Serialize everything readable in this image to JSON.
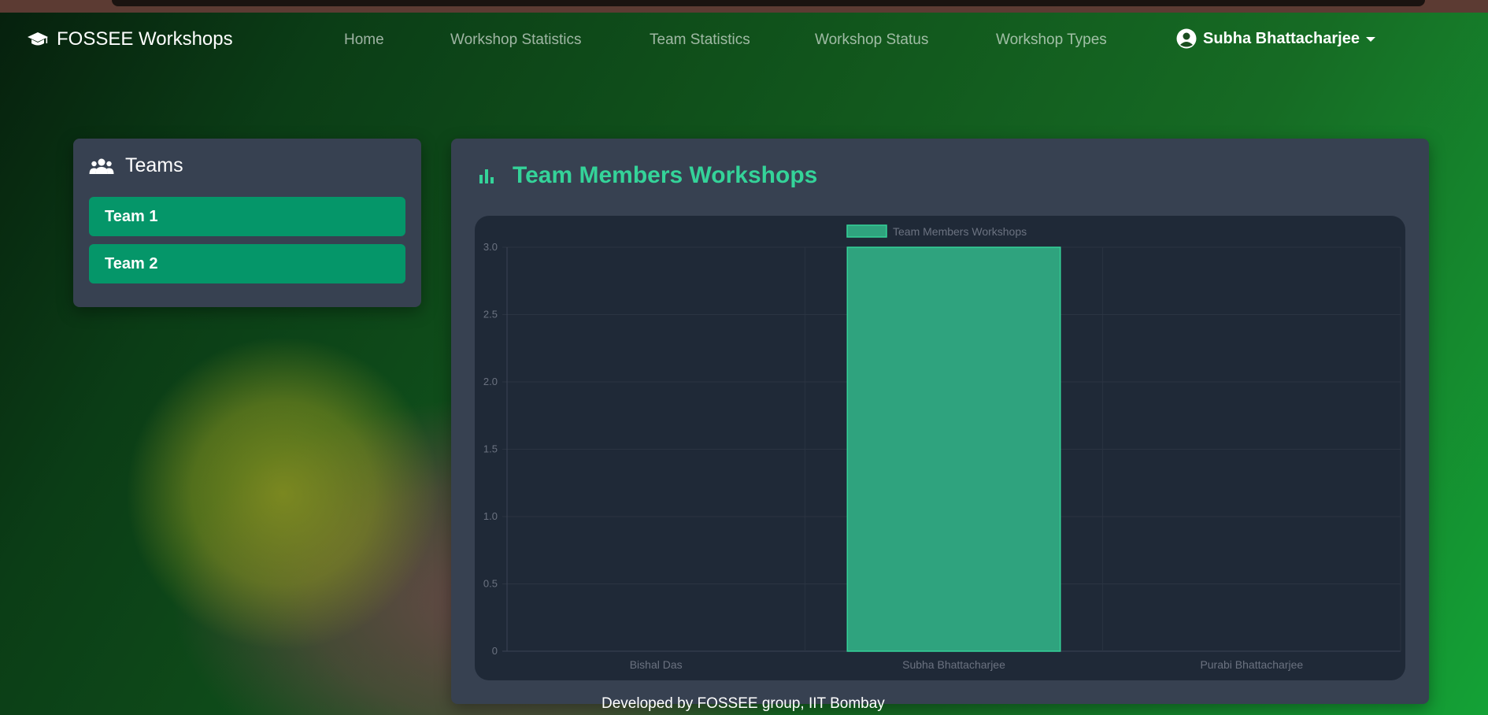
{
  "navbar": {
    "brand": "FOSSEE Workshops",
    "brand_icon": "graduation-cap-icon",
    "links": [
      {
        "label": "Home"
      },
      {
        "label": "Workshop Statistics"
      },
      {
        "label": "Team Statistics"
      },
      {
        "label": "Workshop Status"
      },
      {
        "label": "Workshop Types"
      }
    ],
    "user": {
      "name": "Subha Bhattacharjee",
      "icon": "user-circle-icon"
    }
  },
  "teams": {
    "title": "Teams",
    "icon": "users-icon",
    "items": [
      {
        "label": "Team 1"
      },
      {
        "label": "Team 2"
      }
    ]
  },
  "chart_card": {
    "title": "Team Members Workshops",
    "icon": "bar-chart-icon"
  },
  "chart_data": {
    "type": "bar",
    "categories": [
      "Bishal Das",
      "Subha Bhattacharjee",
      "Purabi Bhattacharjee"
    ],
    "series": [
      {
        "name": "Team Members Workshops",
        "values": [
          0,
          3,
          0
        ]
      }
    ],
    "ylim": [
      0,
      3
    ],
    "yticks": [
      "0",
      "0.5",
      "1.0",
      "1.5",
      "2.0",
      "2.5",
      "3.0"
    ],
    "ytick_values": [
      0,
      0.5,
      1,
      1.5,
      2,
      2.5,
      3
    ],
    "legend_position": "top-center",
    "grid": true,
    "bar_color": "#2fa37e",
    "bar_border_color": "#34d399"
  },
  "colors": {
    "accent": "#34d399",
    "button": "#059669",
    "card": "#374151",
    "panel": "#1f2937"
  },
  "footer": {
    "text": "Developed by FOSSEE group, IIT Bombay"
  }
}
